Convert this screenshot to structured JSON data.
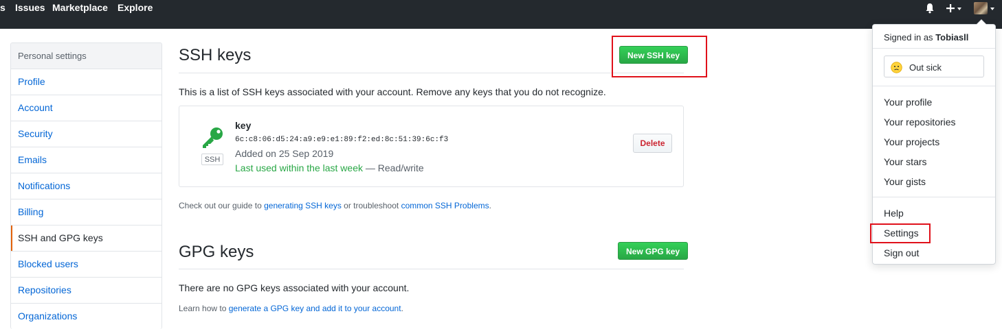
{
  "header": {
    "nav": [
      "s",
      "Issues",
      "Marketplace",
      "Explore"
    ],
    "icons": [
      "bell-icon",
      "plus-icon",
      "avatar"
    ]
  },
  "sidebar": {
    "heading": "Personal settings",
    "items": [
      {
        "label": "Profile"
      },
      {
        "label": "Account"
      },
      {
        "label": "Security"
      },
      {
        "label": "Emails"
      },
      {
        "label": "Notifications"
      },
      {
        "label": "Billing"
      },
      {
        "label": "SSH and GPG keys",
        "selected": true
      },
      {
        "label": "Blocked users"
      },
      {
        "label": "Repositories"
      },
      {
        "label": "Organizations"
      }
    ]
  },
  "ssh": {
    "title": "SSH keys",
    "new_button": "New SSH key",
    "description": "This is a list of SSH keys associated with your account. Remove any keys that you do not recognize.",
    "key": {
      "name": "key",
      "fingerprint": "6c:c8:06:d5:24:a9:e9:e1:89:f2:ed:8c:51:39:6c:f3",
      "added": "Added on 25 Sep 2019",
      "last_used": "Last used within the last week",
      "access": "— Read/write",
      "type_label": "SSH",
      "delete_button": "Delete"
    },
    "guide_prefix": "Check out our guide to",
    "guide_link1": "generating SSH keys",
    "guide_middle": "or troubleshoot",
    "guide_link2": "common SSH Problems",
    "guide_suffix": "."
  },
  "gpg": {
    "title": "GPG keys",
    "new_button": "New GPG key",
    "empty_text": "There are no GPG keys associated with your account.",
    "learn_prefix": "Learn how to",
    "learn_link": "generate a GPG key and add it to your account",
    "learn_suffix": "."
  },
  "dropdown": {
    "signed_in_prefix": "Signed in as",
    "username": "Tobiasll",
    "status": "Out sick",
    "items_group1": [
      "Your profile",
      "Your repositories",
      "Your projects",
      "Your stars",
      "Your gists"
    ],
    "items_group2": [
      "Help",
      "Settings",
      "Sign out"
    ]
  },
  "colors": {
    "header_bg": "#24292e",
    "link": "#0366d6",
    "green_button": "#28a745",
    "highlight_box": "#e0101a",
    "selected_indicator": "#e36209"
  }
}
